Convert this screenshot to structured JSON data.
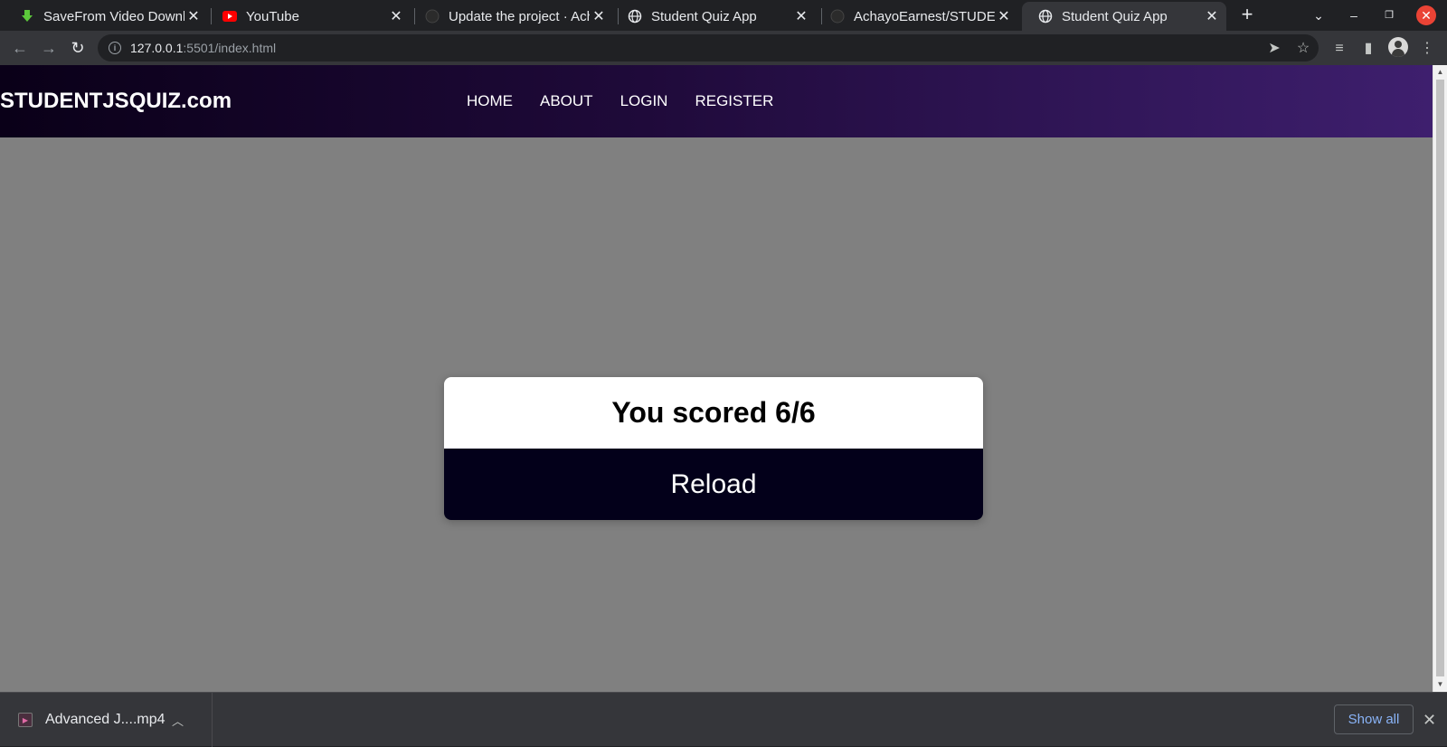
{
  "browser": {
    "tabs": [
      {
        "title": "SaveFrom Video Downlo",
        "icon": "download-arrow-icon",
        "active": false
      },
      {
        "title": "YouTube",
        "icon": "youtube-icon",
        "active": false
      },
      {
        "title": "Update the project · Ach",
        "icon": "github-icon",
        "active": false
      },
      {
        "title": "Student Quiz App",
        "icon": "globe-icon",
        "active": false
      },
      {
        "title": "AchayoEarnest/STUDEN",
        "icon": "github-icon",
        "active": false
      },
      {
        "title": "Student Quiz App",
        "icon": "globe-icon",
        "active": true
      }
    ],
    "url_host": "127.0.0.1",
    "url_rest": ":5501/index.html"
  },
  "site": {
    "logo": "STUDENTJSQUIZ.com",
    "nav": [
      "HOME",
      "ABOUT",
      "LOGIN",
      "REGISTER"
    ]
  },
  "result": {
    "score_text": "You scored 6/6",
    "reload_label": "Reload"
  },
  "downloads": {
    "file_name": "Advanced J....mp4",
    "show_all": "Show all"
  },
  "colors": {
    "header_gradient_start": "#0a0018",
    "header_gradient_end": "#3e1f6e",
    "page_bg": "#808080",
    "reload_bg": "#03001a"
  }
}
